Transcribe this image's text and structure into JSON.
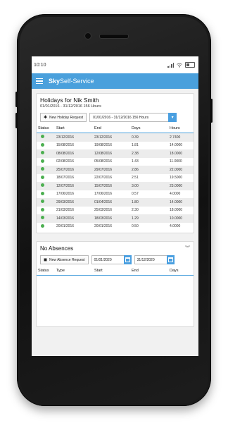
{
  "status_bar": {
    "time": "10:10",
    "icons": [
      "signal-icon",
      "wifi-icon",
      "battery-icon"
    ]
  },
  "app_bar": {
    "brand_bold": "Sky",
    "brand_rest": "Self-Service",
    "menu_icon": "hamburger-icon"
  },
  "holidays": {
    "title": "Holidays for Nik Smith",
    "subtitle": "01/01/2016 - 31/12/2016 156 Hours",
    "new_request_label": "New Holiday Request",
    "period_selected": "01/01/2016 - 31/12/2016 156 Hours",
    "columns": [
      "Status",
      "Start",
      "End",
      "Days",
      "Hours"
    ],
    "rows": [
      {
        "start": "23/12/2016",
        "end": "23/12/2016",
        "days": "0.39",
        "hours": "2.7400"
      },
      {
        "start": "15/08/2016",
        "end": "19/08/2016",
        "days": "1.81",
        "hours": "14.0000"
      },
      {
        "start": "08/08/2016",
        "end": "12/08/2016",
        "days": "2.38",
        "hours": "18.0000"
      },
      {
        "start": "02/08/2016",
        "end": "05/08/2016",
        "days": "1.43",
        "hours": "11.0000"
      },
      {
        "start": "25/07/2016",
        "end": "29/07/2016",
        "days": "2.86",
        "hours": "22.0000"
      },
      {
        "start": "18/07/2016",
        "end": "22/07/2016",
        "days": "2.51",
        "hours": "19.5000"
      },
      {
        "start": "12/07/2016",
        "end": "15/07/2016",
        "days": "3.00",
        "hours": "23.0000"
      },
      {
        "start": "17/06/2016",
        "end": "17/06/2016",
        "days": "0.57",
        "hours": "4.0000"
      },
      {
        "start": "29/03/2016",
        "end": "01/04/2016",
        "days": "1.80",
        "hours": "14.0000"
      },
      {
        "start": "21/03/2016",
        "end": "25/03/2016",
        "days": "2.30",
        "hours": "18.0000"
      },
      {
        "start": "14/03/2016",
        "end": "18/03/2016",
        "days": "1.29",
        "hours": "10.0000"
      },
      {
        "start": "20/01/2016",
        "end": "20/01/2016",
        "days": "0.50",
        "hours": "4.0000"
      }
    ],
    "status_color": "#4caf50"
  },
  "absences": {
    "title": "No Absences",
    "new_request_label": "New Absence Request",
    "date_from": "01/01/2020",
    "date_to": "31/12/2020",
    "columns": [
      "Status",
      "Type",
      "Start",
      "End",
      "Days"
    ]
  },
  "colors": {
    "accent": "#4aa0dc",
    "button_blue": "#4a9fe0"
  }
}
